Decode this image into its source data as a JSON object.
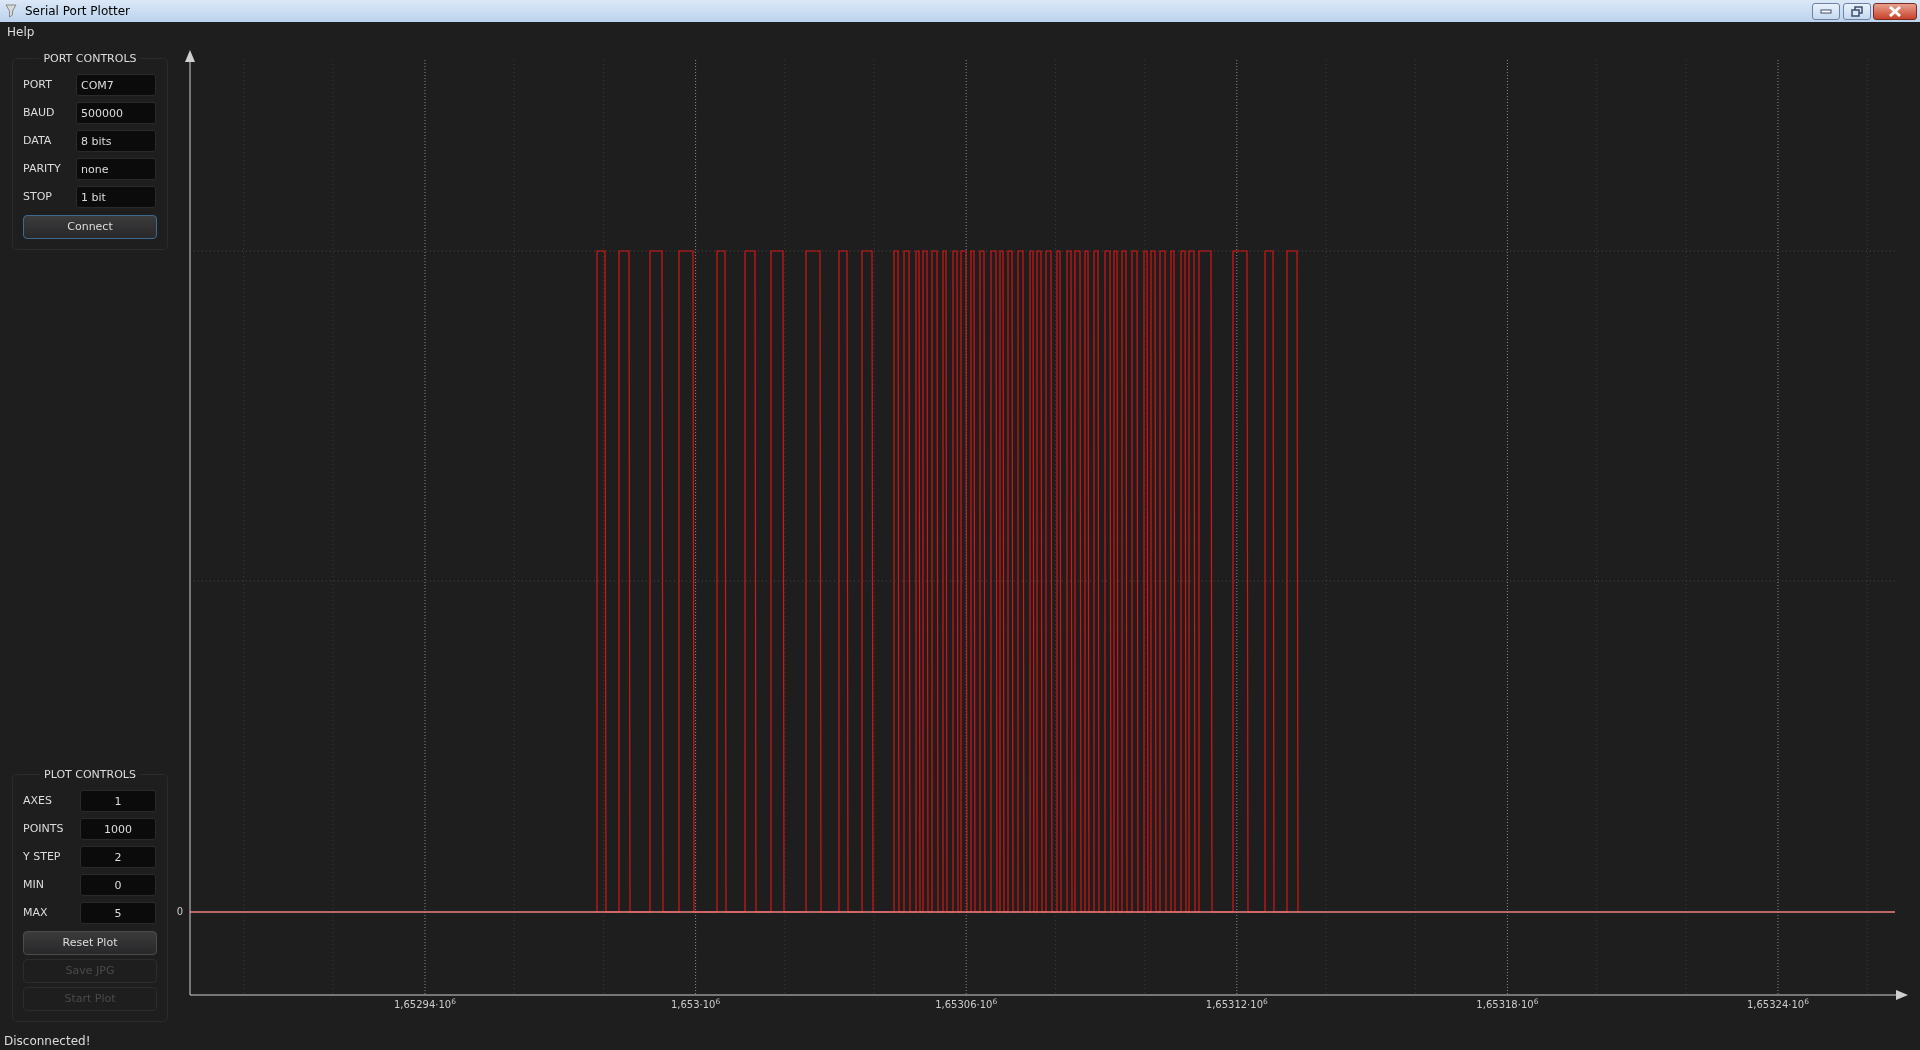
{
  "window": {
    "title": "Serial Port Plotter"
  },
  "menu": [
    "Help"
  ],
  "port_controls": {
    "title": "PORT CONTROLS",
    "fields": [
      {
        "label": "PORT",
        "value": "COM7"
      },
      {
        "label": "BAUD",
        "value": "500000"
      },
      {
        "label": "DATA",
        "value": "8 bits"
      },
      {
        "label": "PARITY",
        "value": "none"
      },
      {
        "label": "STOP",
        "value": "1 bit"
      }
    ],
    "buttons": [
      {
        "label": "Connect",
        "disabled": false,
        "focused": true
      }
    ]
  },
  "plot_controls": {
    "title": "PLOT CONTROLS",
    "fields": [
      {
        "label": "AXES",
        "value": "1"
      },
      {
        "label": "POINTS",
        "value": "1000"
      },
      {
        "label": "Y STEP",
        "value": "2"
      },
      {
        "label": "MIN",
        "value": "0"
      },
      {
        "label": "MAX",
        "value": "5"
      }
    ],
    "buttons": [
      {
        "label": "Reset Plot",
        "disabled": false,
        "focused": false
      },
      {
        "label": "Save JPG",
        "disabled": true,
        "focused": false
      },
      {
        "label": "Start Plot",
        "disabled": true,
        "focused": false
      }
    ]
  },
  "plot": {
    "y_tick_labels": [
      "0"
    ],
    "x_tick_labels": [
      "1,65294·10$^{6}$",
      "1,653·10$^{6}$",
      "1,65306·10$^{6}$",
      "1,65312·10$^{6}$",
      "1,65318·10$^{6}$",
      "1,65324·10$^{6}$"
    ]
  },
  "status_bar": "Disconnected!"
}
